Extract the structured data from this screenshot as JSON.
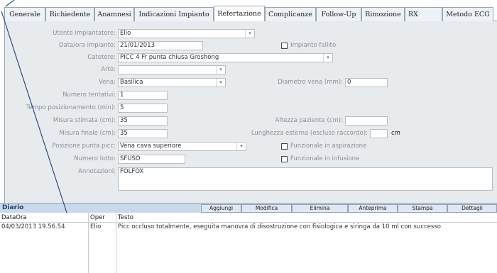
{
  "tabs": [
    {
      "label": "Generale"
    },
    {
      "label": "Richiedente"
    },
    {
      "label": "Anamnesi"
    },
    {
      "label": "Indicazioni Impianto"
    },
    {
      "label": "Refertazione"
    },
    {
      "label": "Complicanze"
    },
    {
      "label": "Follow-Up"
    },
    {
      "label": "Rimozione"
    },
    {
      "label": "RX"
    },
    {
      "label": "Metodo ECG"
    }
  ],
  "active_tab": "Refertazione",
  "form": {
    "utente_label": "Utente impiantatore:",
    "utente_value": "Elio",
    "data_label": "Data/ora impianto:",
    "data_value": "21/01/2013",
    "fallito_label": "Impianto fallito",
    "fallito_checked": false,
    "catetere_label": "Catetere:",
    "catetere_value": "PICC 4 Fr punta chiusa Groshong",
    "arto_label": "Arto:",
    "arto_value": "",
    "vena_label": "Vena:",
    "vena_value": "Basilica",
    "diametro_label": "Diametro vena (mm):",
    "diametro_value": "0",
    "tentativi_label": "Numero tentativi:",
    "tentativi_value": "1",
    "tempo_label": "Tempo posizionamento (min):",
    "tempo_value": "5",
    "stimata_label": "Misura stimata (cm):",
    "stimata_value": "35",
    "altezza_label": "Altezza paziente (cm):",
    "altezza_value": "",
    "finale_label": "Misura finale (cm):",
    "finale_value": "35",
    "lunghezza_label": "Lunghezza esterna (escluso raccordo):",
    "lunghezza_value": "",
    "lunghezza_unit": "cm",
    "punta_label": "Posizione punta picc:",
    "punta_value": "Vena cava superiore",
    "aspirazione_label": "Funzionale in aspirazione",
    "aspirazione_checked": false,
    "lotto_label": "Numero lotto:",
    "lotto_value": "SFUSO",
    "infusione_label": "Funzionale in infusione",
    "infusione_checked": false,
    "annotazioni_label": "Annotazioni:",
    "annotazioni_value": "FOLFOX"
  },
  "diary": {
    "title": "Diario",
    "buttons": {
      "aggiungi": "Aggiungi",
      "modifica": "Modifica",
      "elimina": "Elimina",
      "anteprima": "Anteprima",
      "stampa": "Stampa",
      "dettagli": "Dettagli"
    },
    "columns": [
      "DataOra",
      "Oper",
      "Testo"
    ],
    "rows": [
      [
        "04/03/2013 19.56.54",
        "Elio",
        "Picc occluso totalmente, eseguita manovra di disostruzione con fisiologica e siringa da 10 ml con successo"
      ]
    ]
  },
  "colors": {
    "form_bg": "#e8ebee",
    "diary_header_bg": "#c9d9ec",
    "pointer_line": "#2b4c7e"
  },
  "icons": {
    "combo_arrow": "chevron-down-icon",
    "checkbox": "checkbox-icon"
  }
}
